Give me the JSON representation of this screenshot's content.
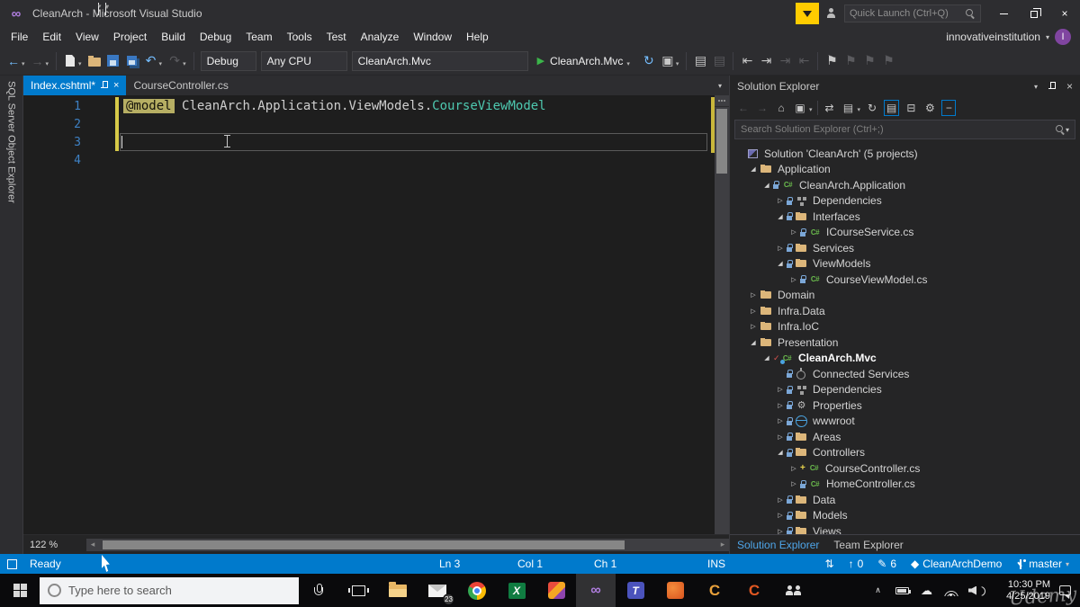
{
  "colors": {
    "accent": "#007acc",
    "chrome": "#2d2d30",
    "editor_bg": "#1e1e1e",
    "panel_bg": "#252526",
    "statusbar": "#007acc",
    "razor_directive_bg": "#b6ae63",
    "type_teal": "#4ec9b0",
    "changed_line_yellow": "#d7ca48",
    "folder_khaki": "#dcb67a"
  },
  "icons": {
    "back": "←",
    "forward": "→",
    "caret": "▾",
    "undo": "↶",
    "redo": "↷",
    "play": "▶",
    "refresh": "↻",
    "close": "×",
    "collapsed": "▷",
    "expanded": "◢",
    "home": "⌂",
    "sync": "⇄",
    "docs": "▤",
    "docs2": "▣",
    "collapse_all": "⊟",
    "gear": "⚙",
    "outdent": "⇤",
    "indent": "⇥",
    "flag": "⚑",
    "pencil": "✎",
    "up_arrow": "↑",
    "sync_arrows": "⇅",
    "diamond": "◆",
    "cloud": "☁",
    "chevron_up": "∧",
    "csharp": "C#",
    "plus": "+",
    "check": "✓",
    "infinity": "∞",
    "letter_x": "X",
    "letter_t": "T",
    "letter_c": "C",
    "minus": "−",
    "scroll_left": "◂",
    "scroll_right": "▸"
  },
  "title_bar": {
    "title": "CleanArch - Microsoft Visual Studio",
    "quick_launch_placeholder": "Quick Launch (Ctrl+Q)"
  },
  "menu": {
    "items": [
      "File",
      "Edit",
      "View",
      "Project",
      "Build",
      "Debug",
      "Team",
      "Tools",
      "Test",
      "Analyze",
      "Window",
      "Help"
    ],
    "account": "innovativeinstitution",
    "avatar": "I"
  },
  "toolbar": {
    "config": "Debug",
    "platform": "Any CPU",
    "project": "CleanArch.Mvc",
    "run_label": "CleanArch.Mvc"
  },
  "side_strip": {
    "label": "SQL Server Object Explorer"
  },
  "editor": {
    "tabs": [
      {
        "label": "Index.cshtml*",
        "active": true
      },
      {
        "label": "CourseController.cs",
        "active": false
      }
    ],
    "code": {
      "line_numbers": [
        "1",
        "2",
        "3",
        "4"
      ],
      "current_line": 3,
      "changed_lines": [
        1,
        2,
        3
      ],
      "line1": {
        "directive": "@model",
        "namespace": "CleanArch.Application.ViewModels.",
        "type": "CourseViewModel"
      }
    },
    "zoom": "122 %"
  },
  "solution_explorer": {
    "title": "Solution Explorer",
    "search_placeholder": "Search Solution Explorer (Ctrl+;)",
    "tree": [
      {
        "label": "Solution 'CleanArch' (5 projects)",
        "level": 0,
        "exp": "none",
        "icon": "solution"
      },
      {
        "label": "Application",
        "level": 1,
        "exp": "open",
        "icon": "folder"
      },
      {
        "label": "CleanArch.Application",
        "level": 2,
        "exp": "open",
        "icon": "csproj",
        "lock": true
      },
      {
        "label": "Dependencies",
        "level": 3,
        "exp": "closed",
        "icon": "deps",
        "lock": true
      },
      {
        "label": "Interfaces",
        "level": 3,
        "exp": "open",
        "icon": "folder",
        "lock": true
      },
      {
        "label": "ICourseService.cs",
        "level": 4,
        "exp": "closed",
        "icon": "cs",
        "lock": true
      },
      {
        "label": "Services",
        "level": 3,
        "exp": "closed",
        "icon": "folder",
        "lock": true
      },
      {
        "label": "ViewModels",
        "level": 3,
        "exp": "open",
        "icon": "folder",
        "lock": true
      },
      {
        "label": "CourseViewModel.cs",
        "level": 4,
        "exp": "closed",
        "icon": "cs",
        "lock": true
      },
      {
        "label": "Domain",
        "level": 1,
        "exp": "closed",
        "icon": "folder"
      },
      {
        "label": "Infra.Data",
        "level": 1,
        "exp": "closed",
        "icon": "folder"
      },
      {
        "label": "Infra.IoC",
        "level": 1,
        "exp": "closed",
        "icon": "folder"
      },
      {
        "label": "Presentation",
        "level": 1,
        "exp": "open",
        "icon": "folder"
      },
      {
        "label": "CleanArch.Mvc",
        "level": 2,
        "exp": "open",
        "icon": "webproj",
        "check": true,
        "bold": true
      },
      {
        "label": "Connected Services",
        "level": 3,
        "exp": "none",
        "icon": "plug",
        "lock": true
      },
      {
        "label": "Dependencies",
        "level": 3,
        "exp": "closed",
        "icon": "deps",
        "lock": true
      },
      {
        "label": "Properties",
        "level": 3,
        "exp": "closed",
        "icon": "wrench",
        "lock": true
      },
      {
        "label": "wwwroot",
        "level": 3,
        "exp": "closed",
        "icon": "globe",
        "lock": true
      },
      {
        "label": "Areas",
        "level": 3,
        "exp": "closed",
        "icon": "folder",
        "lock": true
      },
      {
        "label": "Controllers",
        "level": 3,
        "exp": "open",
        "icon": "folder",
        "lock": true
      },
      {
        "label": "CourseController.cs",
        "level": 4,
        "exp": "closed",
        "icon": "cs",
        "added": true
      },
      {
        "label": "HomeController.cs",
        "level": 4,
        "exp": "closed",
        "icon": "cs",
        "lock": true
      },
      {
        "label": "Data",
        "level": 3,
        "exp": "closed",
        "icon": "folder",
        "lock": true
      },
      {
        "label": "Models",
        "level": 3,
        "exp": "closed",
        "icon": "folder",
        "lock": true
      },
      {
        "label": "Views",
        "level": 3,
        "exp": "closed",
        "icon": "folder",
        "lock": true
      }
    ],
    "bottom_tabs": [
      {
        "label": "Solution Explorer",
        "active": true
      },
      {
        "label": "Team Explorer",
        "active": false
      }
    ]
  },
  "status_bar": {
    "ready": "Ready",
    "ln": "Ln 3",
    "col": "Col 1",
    "ch": "Ch 1",
    "mode": "INS",
    "outgoing": "0",
    "edits": "6",
    "repo": "CleanArchDemo",
    "branch": "master"
  },
  "taskbar": {
    "search_placeholder": "Type here to search",
    "mail_badge": "23",
    "time": "10:30 PM",
    "date": "4/25/2019",
    "watermark": "Udemy"
  }
}
